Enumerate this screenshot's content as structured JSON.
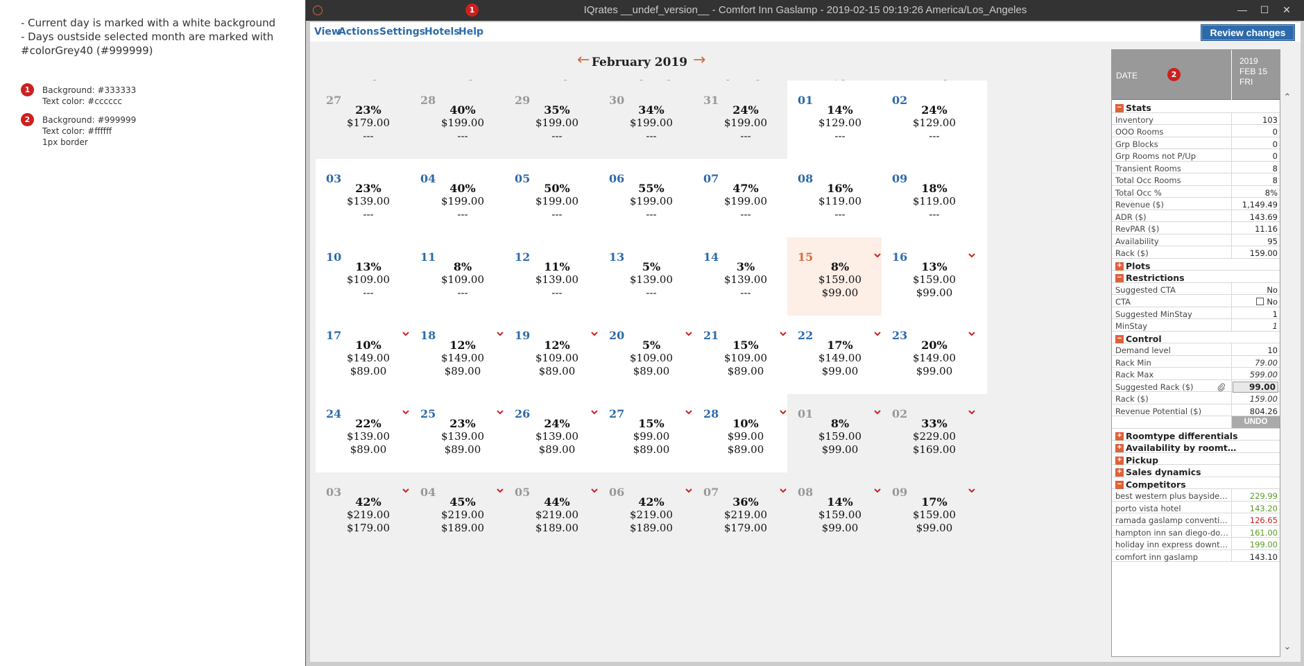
{
  "notes": {
    "line1": "- Current day is marked with a white background",
    "line2": "- Days oustside selected month are marked with",
    "line3": "#colorGrey40 (#999999)",
    "legend": [
      {
        "badge": "1",
        "lines": [
          "Background: #333333",
          "Text color: #cccccc"
        ]
      },
      {
        "badge": "2",
        "lines": [
          "Background: #999999",
          "Text color: #ffffff",
          "1px border"
        ]
      }
    ]
  },
  "window": {
    "title": "IQrates __undef_version__ - Comfort Inn Gaslamp - 2019-02-15 09:19:26 America/Los_Angeles",
    "badge": "1",
    "buttons": [
      "—",
      "☐",
      "✕"
    ]
  },
  "menu": {
    "items": [
      "View",
      "Actions",
      "Settings",
      "Hotels",
      "Help"
    ],
    "review_label": "Review changes"
  },
  "calendar": {
    "month_title": "February 2019",
    "prev_arrow": "←",
    "next_arrow": "→",
    "weekdays": [
      "Sunday",
      "Monday",
      "Tuesday",
      "Wednesday",
      "Thursday",
      "Friday",
      "Saturday"
    ],
    "weeks": [
      [
        {
          "day": "27",
          "occ": "23%",
          "rate": "$179.00",
          "sugg": "---",
          "state": "outside",
          "chevron": false
        },
        {
          "day": "28",
          "occ": "40%",
          "rate": "$199.00",
          "sugg": "---",
          "state": "outside",
          "chevron": false
        },
        {
          "day": "29",
          "occ": "35%",
          "rate": "$199.00",
          "sugg": "---",
          "state": "outside",
          "chevron": false
        },
        {
          "day": "30",
          "occ": "34%",
          "rate": "$199.00",
          "sugg": "---",
          "state": "outside",
          "chevron": false
        },
        {
          "day": "31",
          "occ": "24%",
          "rate": "$199.00",
          "sugg": "---",
          "state": "outside",
          "chevron": false
        },
        {
          "day": "01",
          "occ": "14%",
          "rate": "$129.00",
          "sugg": "---",
          "state": "normal",
          "chevron": false
        },
        {
          "day": "02",
          "occ": "24%",
          "rate": "$129.00",
          "sugg": "---",
          "state": "normal",
          "chevron": false
        }
      ],
      [
        {
          "day": "03",
          "occ": "23%",
          "rate": "$139.00",
          "sugg": "---",
          "state": "normal",
          "chevron": false
        },
        {
          "day": "04",
          "occ": "40%",
          "rate": "$199.00",
          "sugg": "---",
          "state": "normal",
          "chevron": false
        },
        {
          "day": "05",
          "occ": "50%",
          "rate": "$199.00",
          "sugg": "---",
          "state": "normal",
          "chevron": false
        },
        {
          "day": "06",
          "occ": "55%",
          "rate": "$199.00",
          "sugg": "---",
          "state": "normal",
          "chevron": false
        },
        {
          "day": "07",
          "occ": "47%",
          "rate": "$199.00",
          "sugg": "---",
          "state": "normal",
          "chevron": false
        },
        {
          "day": "08",
          "occ": "16%",
          "rate": "$119.00",
          "sugg": "---",
          "state": "normal",
          "chevron": false
        },
        {
          "day": "09",
          "occ": "18%",
          "rate": "$119.00",
          "sugg": "---",
          "state": "normal",
          "chevron": false
        }
      ],
      [
        {
          "day": "10",
          "occ": "13%",
          "rate": "$109.00",
          "sugg": "---",
          "state": "normal",
          "chevron": false
        },
        {
          "day": "11",
          "occ": "8%",
          "rate": "$109.00",
          "sugg": "---",
          "state": "normal",
          "chevron": false
        },
        {
          "day": "12",
          "occ": "11%",
          "rate": "$139.00",
          "sugg": "---",
          "state": "normal",
          "chevron": false
        },
        {
          "day": "13",
          "occ": "5%",
          "rate": "$139.00",
          "sugg": "---",
          "state": "normal",
          "chevron": false
        },
        {
          "day": "14",
          "occ": "3%",
          "rate": "$139.00",
          "sugg": "---",
          "state": "normal",
          "chevron": false
        },
        {
          "day": "15",
          "occ": "8%",
          "rate": "$159.00",
          "sugg": "$99.00",
          "state": "today",
          "chevron": true
        },
        {
          "day": "16",
          "occ": "13%",
          "rate": "$159.00",
          "sugg": "$99.00",
          "state": "normal",
          "chevron": true
        }
      ],
      [
        {
          "day": "17",
          "occ": "10%",
          "rate": "$149.00",
          "sugg": "$89.00",
          "state": "normal",
          "chevron": true
        },
        {
          "day": "18",
          "occ": "12%",
          "rate": "$149.00",
          "sugg": "$89.00",
          "state": "normal",
          "chevron": true
        },
        {
          "day": "19",
          "occ": "12%",
          "rate": "$109.00",
          "sugg": "$89.00",
          "state": "normal",
          "chevron": true
        },
        {
          "day": "20",
          "occ": "5%",
          "rate": "$109.00",
          "sugg": "$89.00",
          "state": "normal",
          "chevron": true
        },
        {
          "day": "21",
          "occ": "15%",
          "rate": "$109.00",
          "sugg": "$89.00",
          "state": "normal",
          "chevron": true
        },
        {
          "day": "22",
          "occ": "17%",
          "rate": "$149.00",
          "sugg": "$99.00",
          "state": "normal",
          "chevron": true
        },
        {
          "day": "23",
          "occ": "20%",
          "rate": "$149.00",
          "sugg": "$99.00",
          "state": "normal",
          "chevron": true
        }
      ],
      [
        {
          "day": "24",
          "occ": "22%",
          "rate": "$139.00",
          "sugg": "$89.00",
          "state": "normal",
          "chevron": true
        },
        {
          "day": "25",
          "occ": "23%",
          "rate": "$139.00",
          "sugg": "$89.00",
          "state": "normal",
          "chevron": true
        },
        {
          "day": "26",
          "occ": "24%",
          "rate": "$139.00",
          "sugg": "$89.00",
          "state": "normal",
          "chevron": true
        },
        {
          "day": "27",
          "occ": "15%",
          "rate": "$99.00",
          "sugg": "$89.00",
          "state": "normal",
          "chevron": true
        },
        {
          "day": "28",
          "occ": "10%",
          "rate": "$99.00",
          "sugg": "$89.00",
          "state": "normal",
          "chevron": true
        },
        {
          "day": "01",
          "occ": "8%",
          "rate": "$159.00",
          "sugg": "$99.00",
          "state": "outside",
          "chevron": true
        },
        {
          "day": "02",
          "occ": "33%",
          "rate": "$229.00",
          "sugg": "$169.00",
          "state": "outside",
          "chevron": true
        }
      ],
      [
        {
          "day": "03",
          "occ": "42%",
          "rate": "$219.00",
          "sugg": "$179.00",
          "state": "outside",
          "chevron": true
        },
        {
          "day": "04",
          "occ": "45%",
          "rate": "$219.00",
          "sugg": "$189.00",
          "state": "outside",
          "chevron": true
        },
        {
          "day": "05",
          "occ": "44%",
          "rate": "$219.00",
          "sugg": "$189.00",
          "state": "outside",
          "chevron": true
        },
        {
          "day": "06",
          "occ": "42%",
          "rate": "$219.00",
          "sugg": "$189.00",
          "state": "outside",
          "chevron": true
        },
        {
          "day": "07",
          "occ": "36%",
          "rate": "$219.00",
          "sugg": "$179.00",
          "state": "outside",
          "chevron": true
        },
        {
          "day": "08",
          "occ": "14%",
          "rate": "$159.00",
          "sugg": "$99.00",
          "state": "outside",
          "chevron": true
        },
        {
          "day": "09",
          "occ": "17%",
          "rate": "$159.00",
          "sugg": "$99.00",
          "state": "outside",
          "chevron": true
        }
      ]
    ]
  },
  "panel": {
    "date_label": "DATE",
    "badge": "2",
    "date_col": [
      "2019",
      "FEB 15",
      "FRI"
    ],
    "rows": [
      {
        "type": "section",
        "label": "Stats",
        "toggle": "−"
      },
      {
        "type": "row",
        "label": "Inventory",
        "value": "103"
      },
      {
        "type": "row",
        "label": "OOO Rooms",
        "value": "0"
      },
      {
        "type": "row",
        "label": "Grp Blocks",
        "value": "0"
      },
      {
        "type": "row",
        "label": "Grp Rooms not P/Up",
        "value": "0"
      },
      {
        "type": "row",
        "label": "Transient Rooms",
        "value": "8"
      },
      {
        "type": "row",
        "label": "Total Occ Rooms",
        "value": "8"
      },
      {
        "type": "row",
        "label": "Total Occ %",
        "value": "8%"
      },
      {
        "type": "row",
        "label": "Revenue ($)",
        "value": "1,149.49"
      },
      {
        "type": "row",
        "label": "ADR ($)",
        "value": "143.69"
      },
      {
        "type": "row",
        "label": "RevPAR ($)",
        "value": "11.16"
      },
      {
        "type": "row",
        "label": "Availability",
        "value": "95"
      },
      {
        "type": "row",
        "label": "Rack ($)",
        "value": "159.00"
      },
      {
        "type": "section",
        "label": "Plots",
        "toggle": "+"
      },
      {
        "type": "section",
        "label": "Restrictions",
        "toggle": "−"
      },
      {
        "type": "row",
        "label": "Suggested CTA",
        "value": "No"
      },
      {
        "type": "checkbox",
        "label": "CTA",
        "value": "No"
      },
      {
        "type": "row",
        "label": "Suggested MinStay",
        "value": "1"
      },
      {
        "type": "italic",
        "label": "MinStay",
        "value": "1"
      },
      {
        "type": "section",
        "label": "Control",
        "toggle": "−"
      },
      {
        "type": "row",
        "label": "Demand level",
        "value": "10"
      },
      {
        "type": "italic",
        "label": "Rack Min",
        "value": "79.00"
      },
      {
        "type": "italic",
        "label": "Rack Max",
        "value": "599.00"
      },
      {
        "type": "input",
        "label": "Suggested Rack ($)",
        "value": "99.00"
      },
      {
        "type": "italic",
        "label": "Rack ($)",
        "value": "159.00"
      },
      {
        "type": "row",
        "label": "Revenue Potential ($)",
        "value": "804.26"
      },
      {
        "type": "undo",
        "label": "",
        "value": "UNDO"
      },
      {
        "type": "section",
        "label": "Roomtype differentials",
        "toggle": "+"
      },
      {
        "type": "section",
        "label": "Availability by roomtype",
        "toggle": "+"
      },
      {
        "type": "section",
        "label": "Pickup",
        "toggle": "+"
      },
      {
        "type": "section",
        "label": "Sales dynamics",
        "toggle": "+"
      },
      {
        "type": "section",
        "label": "Competitors",
        "toggle": "−"
      },
      {
        "type": "comp",
        "label": "best western plus bayside inn",
        "value": "229.99",
        "color": "#5a9a2a"
      },
      {
        "type": "comp",
        "label": "porto vista hotel",
        "value": "143.20",
        "color": "#5a9a2a"
      },
      {
        "type": "comp",
        "label": "ramada gaslamp convention...",
        "value": "126.65",
        "color": "#cc2020"
      },
      {
        "type": "comp",
        "label": "hampton inn san diego-dow...",
        "value": "161.00",
        "color": "#5a9a2a"
      },
      {
        "type": "comp",
        "label": "holiday inn express downto...",
        "value": "199.00",
        "color": "#5a9a2a"
      },
      {
        "type": "comp",
        "label": "comfort inn gaslamp",
        "value": "143.10",
        "color": "#222222"
      }
    ],
    "scroll_up": "⌃",
    "scroll_down": "⌄"
  }
}
